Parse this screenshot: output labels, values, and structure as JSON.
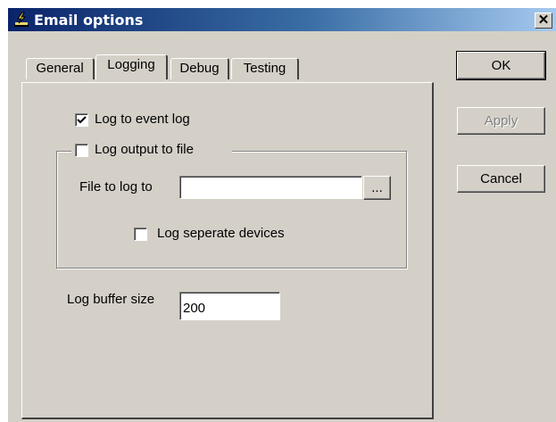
{
  "window": {
    "title": "Email options",
    "icon": "app-icon",
    "close_label": "✕"
  },
  "tabs": [
    {
      "label": "General",
      "active": false
    },
    {
      "label": "Logging",
      "active": true
    },
    {
      "label": "Debug",
      "active": false
    },
    {
      "label": "Testing",
      "active": false
    }
  ],
  "logging": {
    "log_event": {
      "label": "Log to event log",
      "checked": true
    },
    "log_file": {
      "label": "Log output to file",
      "checked": false
    },
    "file_to_log": {
      "label": "File to log to",
      "value": "",
      "browse_label": "..."
    },
    "separate_devices": {
      "label": "Log seperate devices",
      "checked": false
    },
    "buffer_size": {
      "label": "Log buffer size",
      "value": "200"
    }
  },
  "buttons": {
    "ok": "OK",
    "apply": "Apply",
    "cancel": "Cancel"
  }
}
